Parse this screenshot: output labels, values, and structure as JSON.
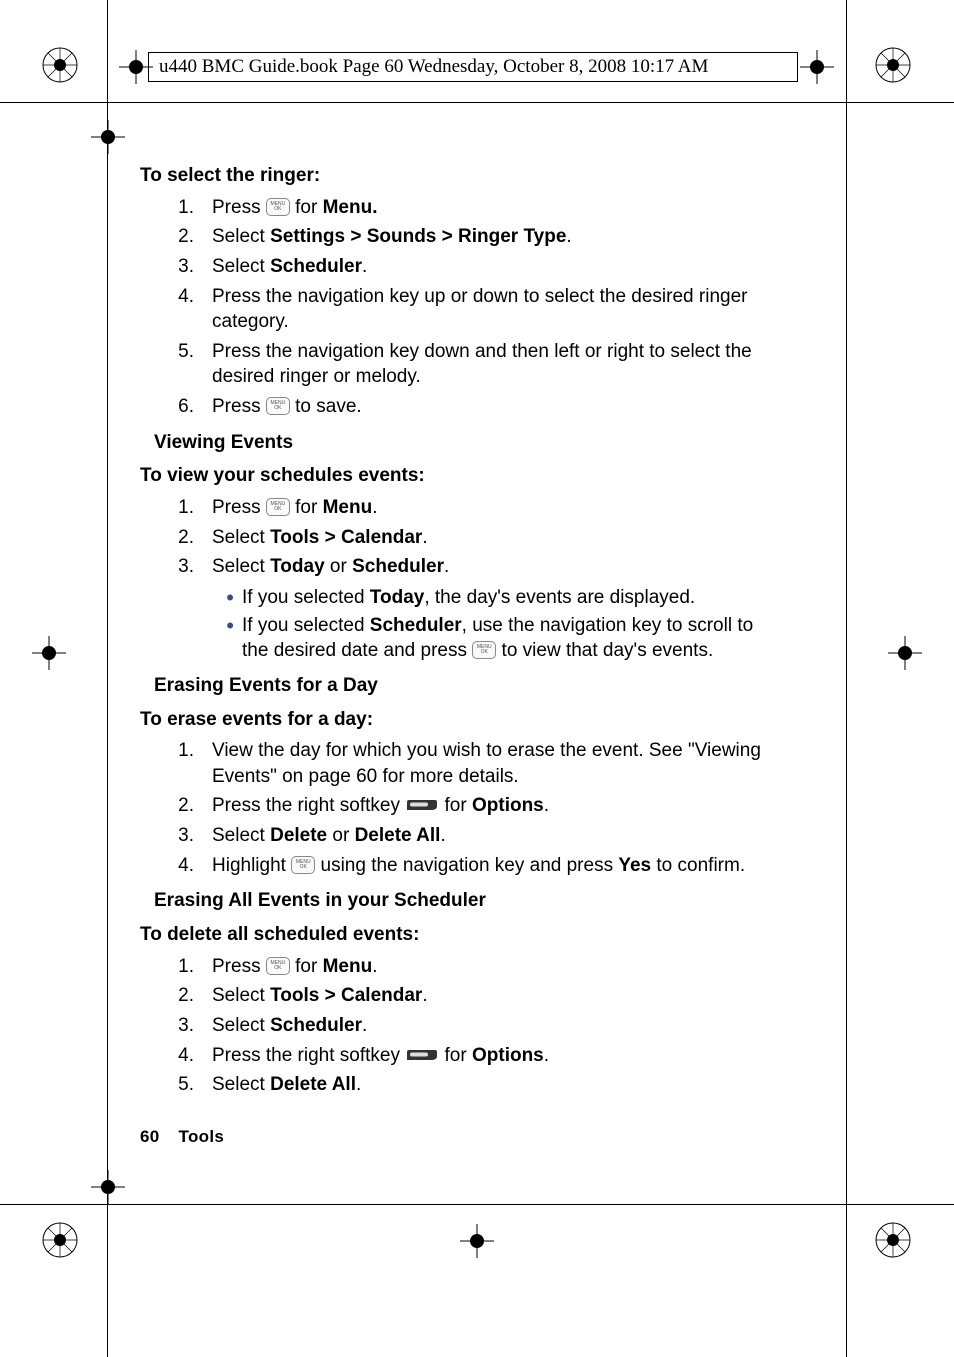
{
  "header_text": "u440 BMC Guide.book  Page 60  Wednesday, October 8, 2008  10:17 AM",
  "sections": {
    "s1_title": "To select the ringer:",
    "s1": [
      {
        "n": "1.",
        "pre": "Press ",
        "post": " for ",
        "bold": "Menu.",
        "tail": "",
        "key": true
      },
      {
        "n": "2.",
        "pre": "Select ",
        "bold": "Settings > Sounds > Ringer Type",
        "tail": "."
      },
      {
        "n": "3.",
        "pre": "Select ",
        "bold": "Scheduler",
        "tail": "."
      },
      {
        "n": "4.",
        "pre": "Press the navigation key up or down to select the desired ringer category."
      },
      {
        "n": "5.",
        "pre": "Press the navigation key down and then left or right to select the desired ringer or melody."
      },
      {
        "n": "6.",
        "pre": "Press ",
        "post": " to save.",
        "key": true
      }
    ],
    "s2_heading": "Viewing Events",
    "s2_title": "To view your schedules events:",
    "s2": [
      {
        "n": "1.",
        "pre": "Press ",
        "post": " for ",
        "bold": "Menu",
        "tail": ".",
        "key": true
      },
      {
        "n": "2.",
        "pre": "Select ",
        "bold": "Tools > Calendar",
        "tail": "."
      },
      {
        "n": "3.",
        "pre": "Select ",
        "bold": "Today",
        "mid": " or ",
        "bold2": "Scheduler",
        "tail": "."
      }
    ],
    "s2_bul": [
      {
        "pre": "If you selected ",
        "bold": "Today",
        "tail": ", the day's events are displayed."
      },
      {
        "pre": "If you selected ",
        "bold": "Scheduler",
        "tail": ", use the navigation key to scroll to the desired date and press ",
        "key": true,
        "tail2": " to view that day's events."
      }
    ],
    "s3_heading": "Erasing Events for a Day",
    "s3_title": "To erase events for a day:",
    "s3": [
      {
        "n": "1.",
        "pre": "View the day for which you wish to erase the event. See \"Viewing Events\" on page 60 for more details."
      },
      {
        "n": "2.",
        "pre": "Press the right softkey ",
        "soft": true,
        "post": " for ",
        "bold": "Options",
        "tail": "."
      },
      {
        "n": "3.",
        "pre": "Select ",
        "bold": "Delete",
        "mid": " or ",
        "bold2": "Delete All",
        "tail": "."
      },
      {
        "n": "4.",
        "pre": "Highlight ",
        "bold": "Yes",
        "post": " using the navigation key and press ",
        "key": true,
        "tail": " to confirm."
      }
    ],
    "s4_heading": "Erasing All Events in your Scheduler",
    "s4_title": "To delete all scheduled events:",
    "s4": [
      {
        "n": "1.",
        "pre": "Press ",
        "post": " for ",
        "bold": "Menu",
        "tail": ".",
        "key": true
      },
      {
        "n": "2.",
        "pre": "Select ",
        "bold": "Tools > Calendar",
        "tail": "."
      },
      {
        "n": "3.",
        "pre": "Select ",
        "bold": "Scheduler",
        "tail": "."
      },
      {
        "n": "4.",
        "pre": "Press the right softkey ",
        "soft": true,
        "post": " for ",
        "bold": "Options",
        "tail": "."
      },
      {
        "n": "5.",
        "pre": "Select ",
        "bold": "Delete All",
        "tail": "."
      }
    ]
  },
  "footer": {
    "page": "60",
    "section": "Tools"
  }
}
